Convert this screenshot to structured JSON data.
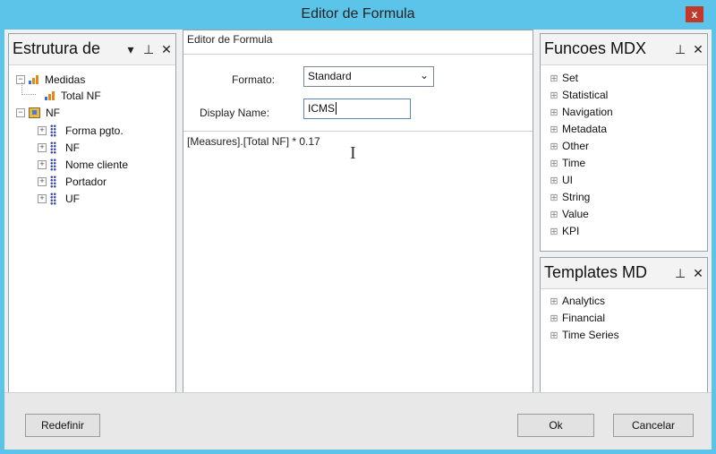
{
  "window": {
    "title": "Editor de Formula",
    "close_glyph": "x"
  },
  "left_panel": {
    "title": "Estrutura de",
    "icons": [
      "chevron-down-icon",
      "pin-icon",
      "close-icon"
    ],
    "tree": [
      {
        "label": "Medidas",
        "icon": "measure-icon",
        "expander": "−"
      },
      {
        "label": "Total NF",
        "icon": "measure-icon"
      },
      {
        "label": "NF",
        "icon": "cube-icon",
        "expander": "−"
      },
      {
        "label": "Forma pgto.",
        "icon": "dimension-icon",
        "expander": "+"
      },
      {
        "label": "NF",
        "icon": "dimension-icon",
        "expander": "+"
      },
      {
        "label": "Nome cliente",
        "icon": "dimension-icon",
        "expander": "+"
      },
      {
        "label": "Portador",
        "icon": "dimension-icon",
        "expander": "+"
      },
      {
        "label": "UF",
        "icon": "dimension-icon",
        "expander": "+"
      }
    ]
  },
  "editor": {
    "header": "Editor de Formula",
    "format_label": "Formato:",
    "format_value": "Standard",
    "display_name_label": "Display Name:",
    "display_name_value": "ICMS",
    "formula": "[Measures].[Total NF] * 0.17",
    "cursor_glyph": "I"
  },
  "mdx_panel": {
    "title": "Funcoes MDX",
    "items": [
      "Set",
      "Statistical",
      "Navigation",
      "Metadata",
      "Other",
      "Time",
      "UI",
      "String",
      "Value",
      "KPI"
    ]
  },
  "templates_panel": {
    "title": "Templates MD",
    "items": [
      "Analytics",
      "Financial",
      "Time Series"
    ]
  },
  "footer": {
    "reset_label": "Redefinir",
    "ok_label": "Ok",
    "cancel_label": "Cancelar"
  },
  "colors": {
    "titlebar": "#5cc4e8",
    "close": "#c0392b",
    "dimension": "#3849b8",
    "measure_orange": "#e08a1e",
    "measure_blue": "#3b6fd0"
  }
}
